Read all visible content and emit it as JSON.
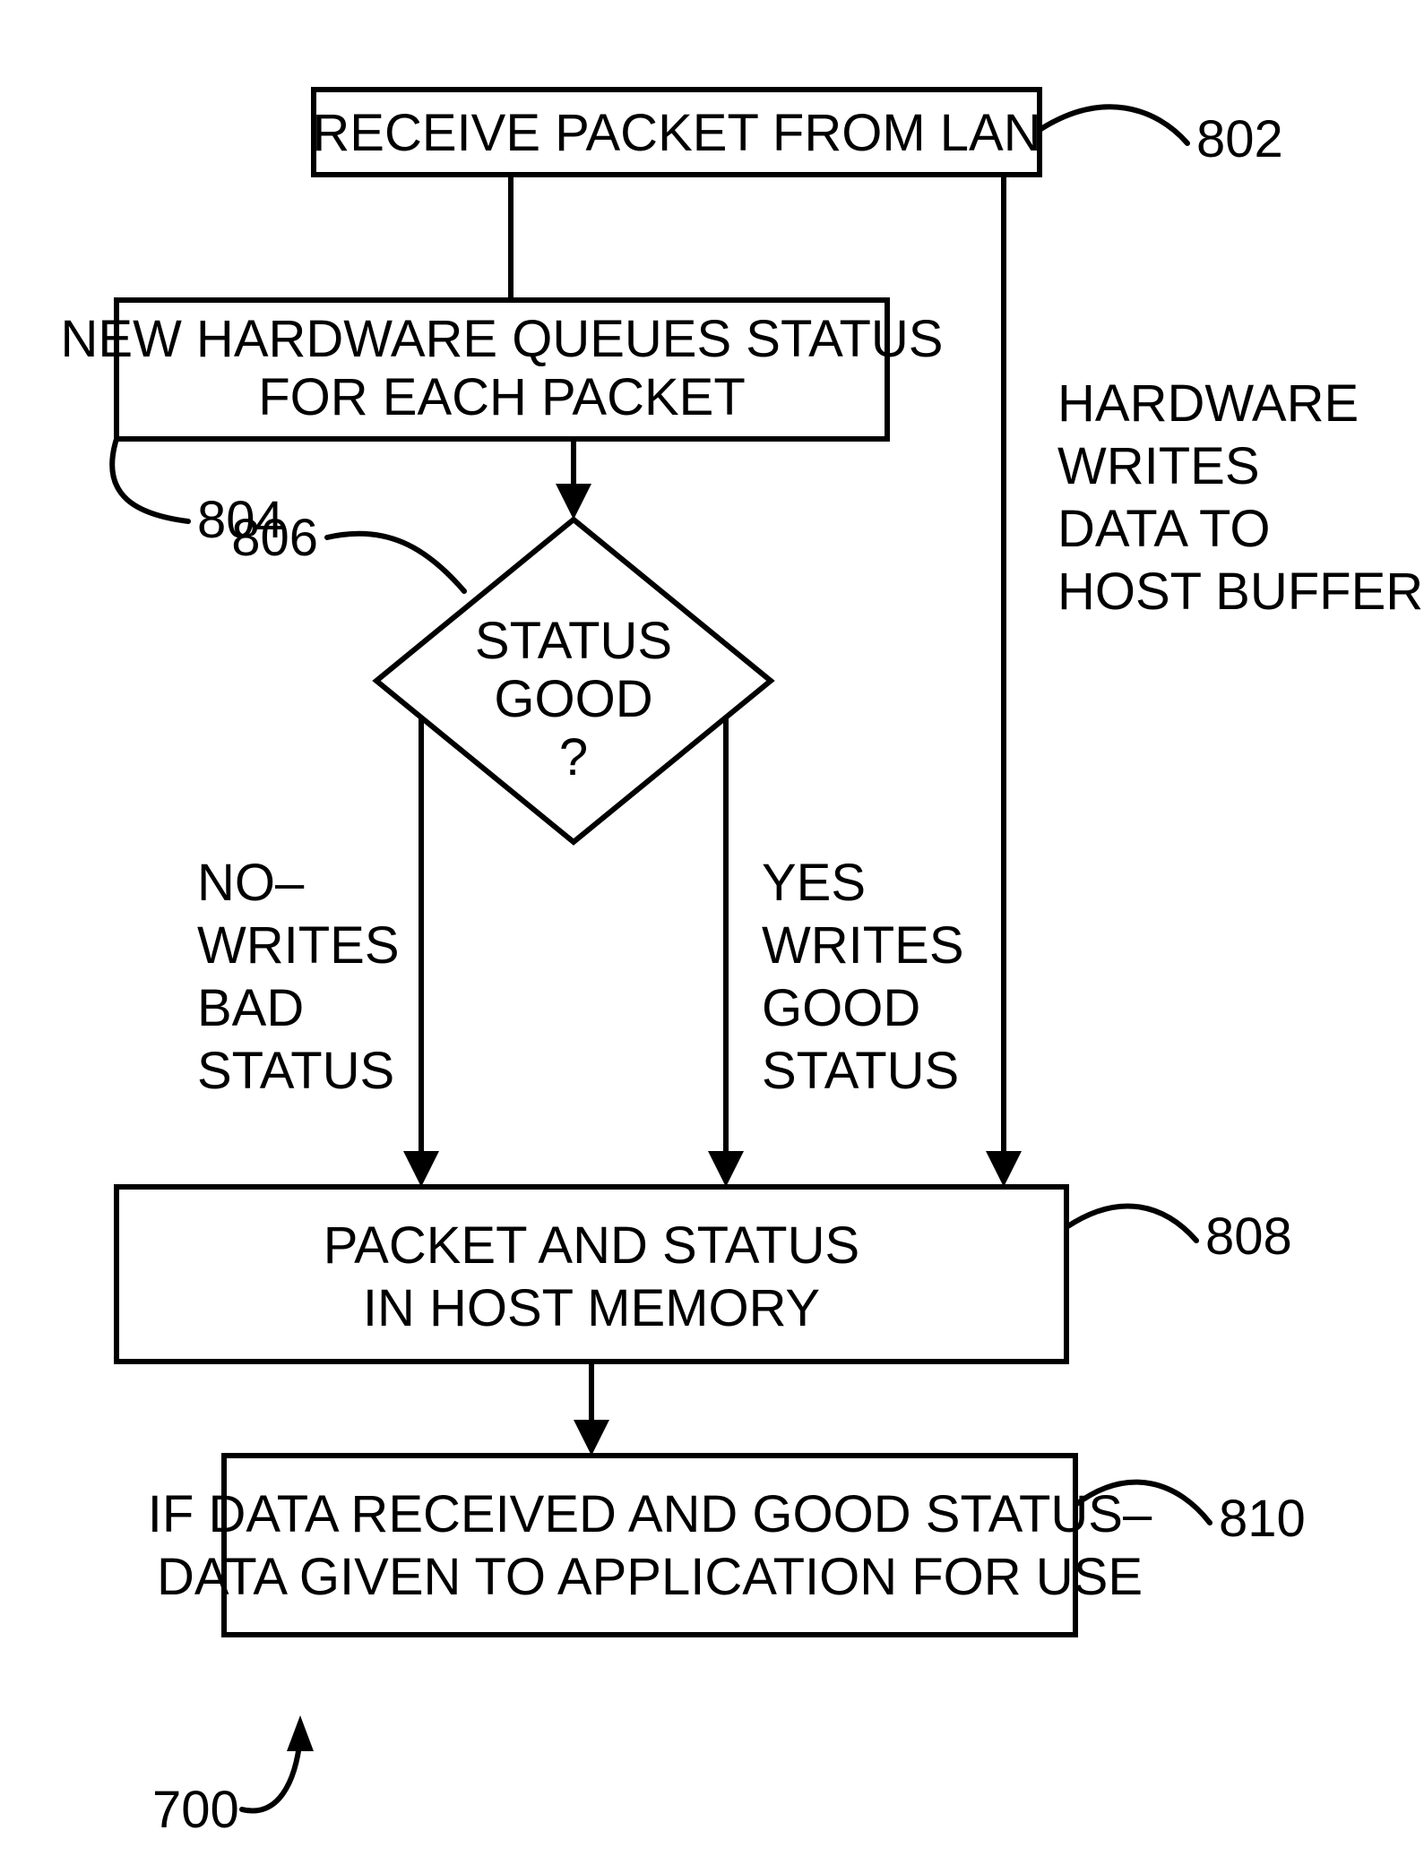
{
  "figure_ref": "700",
  "nodes": {
    "n802": {
      "ref": "802",
      "text": "RECEIVE PACKET FROM LAN"
    },
    "n804": {
      "ref": "804",
      "text_l1": "NEW HARDWARE QUEUES STATUS",
      "text_l2": "FOR EACH PACKET"
    },
    "n806": {
      "ref": "806",
      "text_l1": "STATUS",
      "text_l2": "GOOD",
      "text_l3": "?"
    },
    "n808": {
      "ref": "808",
      "text_l1": "PACKET AND STATUS",
      "text_l2": "IN HOST MEMORY"
    },
    "n810": {
      "ref": "810",
      "text_l1": "IF DATA RECEIVED AND GOOD STATUS–",
      "text_l2": "DATA GIVEN TO APPLICATION FOR USE"
    }
  },
  "edge_labels": {
    "right_side_l1": "HARDWARE",
    "right_side_l2": "WRITES",
    "right_side_l3": "DATA TO",
    "right_side_l4": "HOST BUFFER",
    "no_l1": "NO–",
    "no_l2": "WRITES",
    "no_l3": "BAD",
    "no_l4": "STATUS",
    "yes_l1": "YES",
    "yes_l2": "WRITES",
    "yes_l3": "GOOD",
    "yes_l4": "STATUS"
  }
}
